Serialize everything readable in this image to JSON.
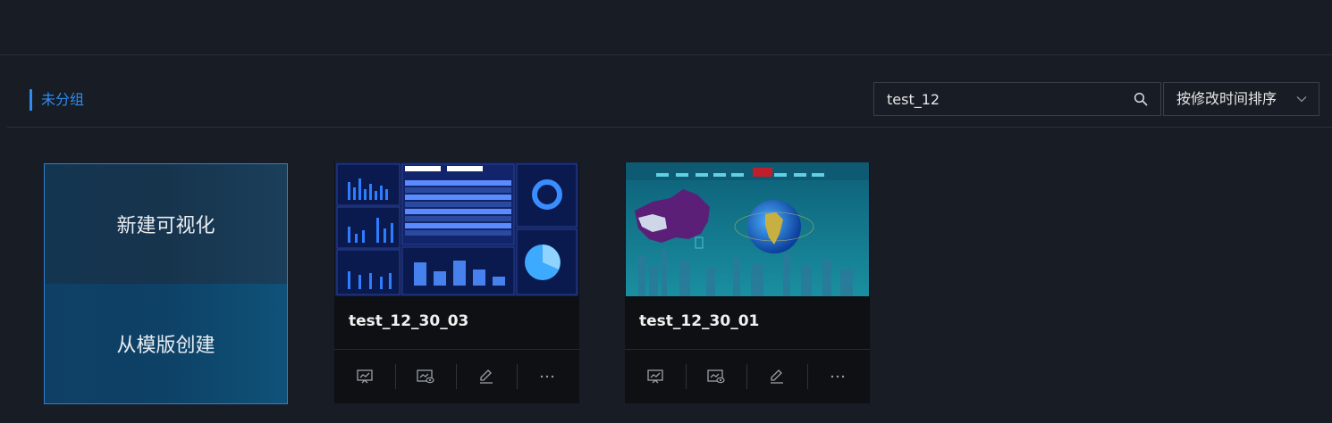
{
  "group": {
    "title": "未分组"
  },
  "search": {
    "value": "test_12"
  },
  "sort": {
    "label": "按修改时间排序"
  },
  "create": {
    "new_label": "新建可视化",
    "template_label": "从模版创建"
  },
  "projects": [
    {
      "name": "test_12_30_03"
    },
    {
      "name": "test_12_30_01"
    }
  ],
  "icons": [
    "search-icon",
    "chevron-down-icon",
    "present-icon",
    "preview-icon",
    "edit-icon",
    "more-icon"
  ],
  "colors": {
    "accent": "#2d8cf0",
    "background": "#181c24",
    "card": "#0e1013"
  }
}
